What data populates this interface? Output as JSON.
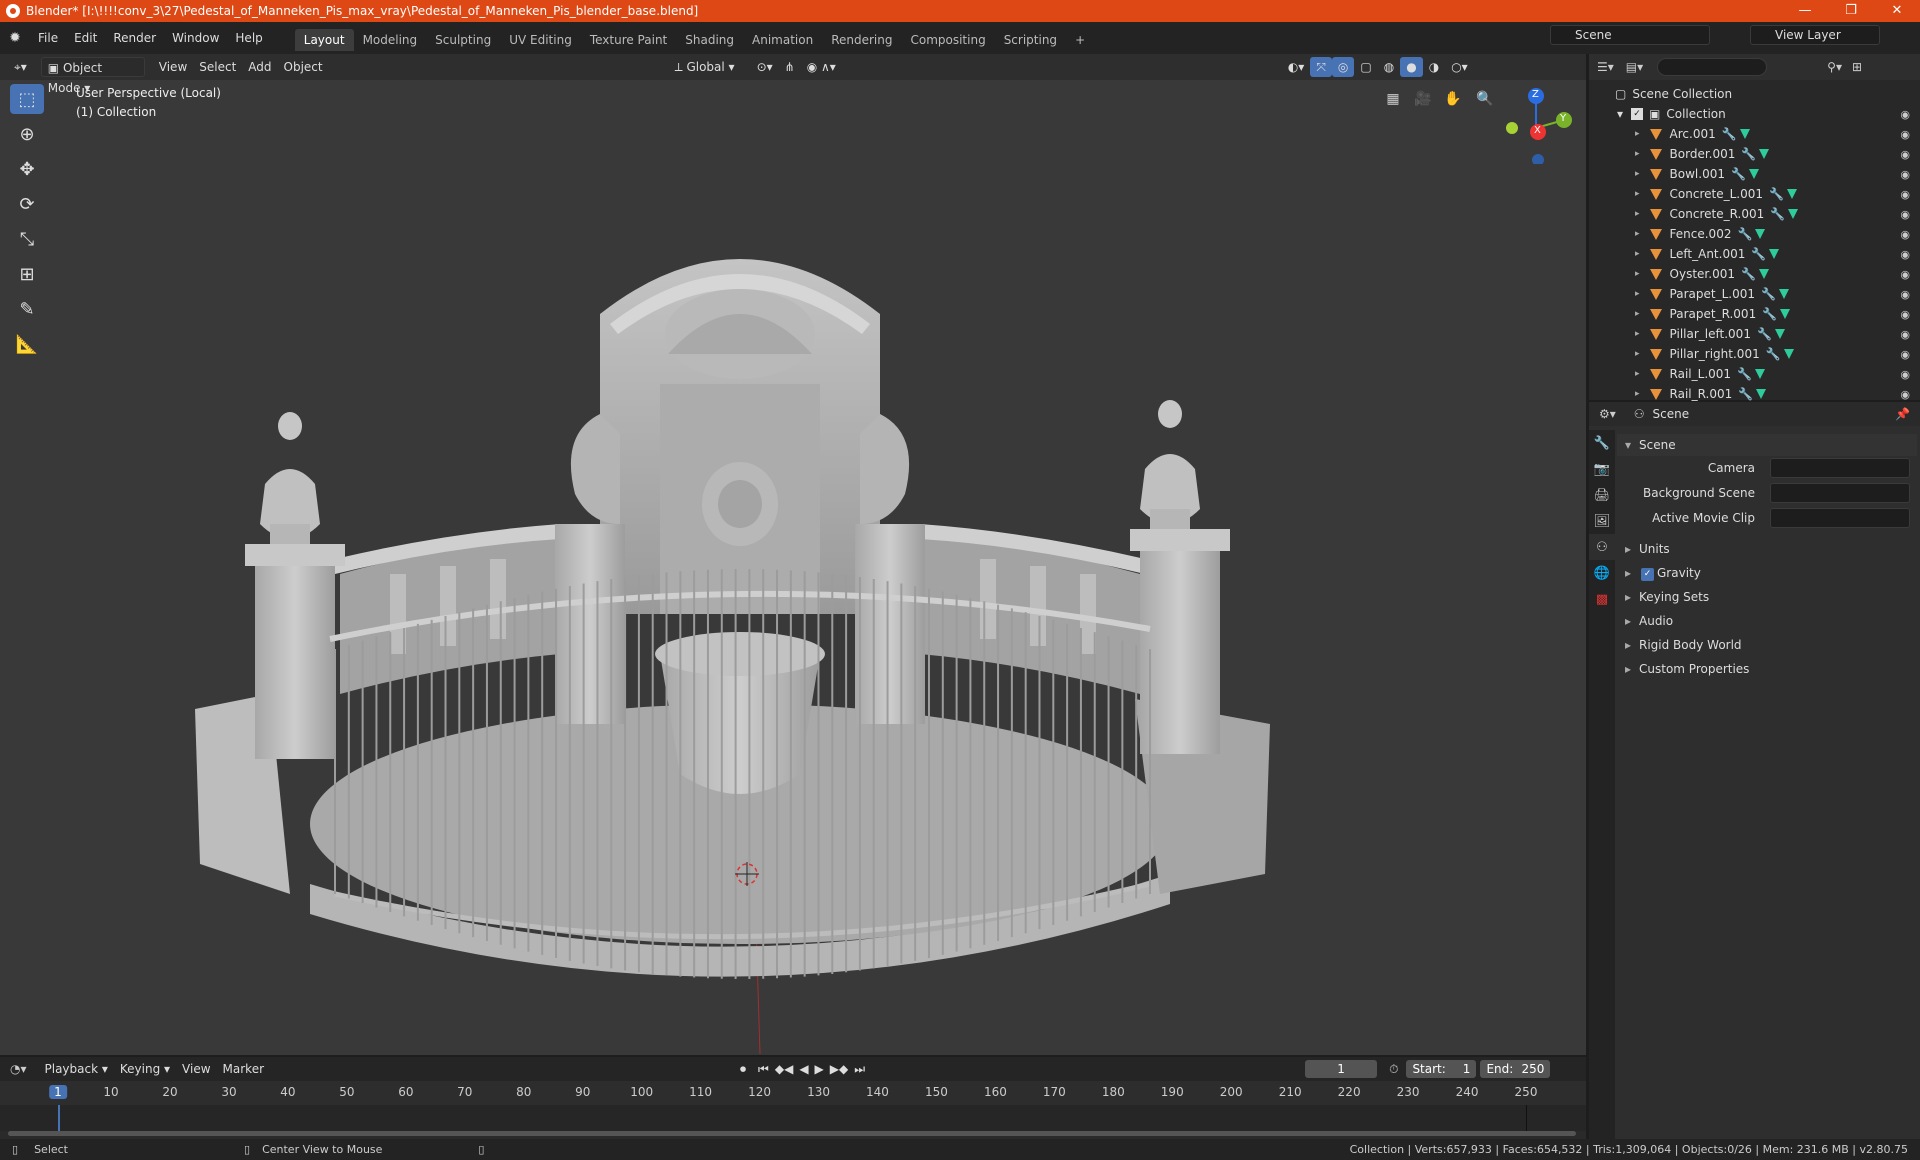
{
  "window": {
    "title": "Blender* [I:\\!!!!conv_3\\27\\Pedestal_of_Manneken_Pis_max_vray\\Pedestal_of_Manneken_Pis_blender_base.blend]",
    "min": "—",
    "max": "❐",
    "close": "✕"
  },
  "menu": [
    "File",
    "Edit",
    "Render",
    "Window",
    "Help"
  ],
  "workspaces": [
    "Layout",
    "Modeling",
    "Sculpting",
    "UV Editing",
    "Texture Paint",
    "Shading",
    "Animation",
    "Rendering",
    "Compositing",
    "Scripting"
  ],
  "workspace_add": "+",
  "scene_name": "Scene",
  "view_layer": "View Layer",
  "viewport": {
    "mode": "Object Mode",
    "menus": [
      "View",
      "Select",
      "Add",
      "Object"
    ],
    "orientation": "Global",
    "perspective_label": "User Perspective (Local)",
    "collection_label": "(1) Collection",
    "gizmo": {
      "z": "Z",
      "y": "Y",
      "x": "X"
    }
  },
  "outliner": {
    "search_placeholder": "",
    "root": "Scene Collection",
    "collection": "Collection",
    "items": [
      "Arc.001",
      "Border.001",
      "Bowl.001",
      "Concrete_L.001",
      "Concrete_R.001",
      "Fence.002",
      "Left_Ant.001",
      "Oyster.001",
      "Parapet_L.001",
      "Parapet_R.001",
      "Pillar_left.001",
      "Pillar_right.001",
      "Rail_L.001",
      "Rail_R.001"
    ]
  },
  "properties": {
    "context": "Scene",
    "panel_scene": "Scene",
    "camera_label": "Camera",
    "bg_scene_label": "Background Scene",
    "movie_clip_label": "Active Movie Clip",
    "panels": [
      "Units",
      "Gravity",
      "Keying Sets",
      "Audio",
      "Rigid Body World",
      "Custom Properties"
    ]
  },
  "timeline": {
    "menus": [
      "Playback",
      "Keying",
      "View",
      "Marker"
    ],
    "current_frame": "1",
    "start_label": "Start:",
    "start": "1",
    "end_label": "End:",
    "end": "250",
    "ticks": [
      "1",
      "10",
      "20",
      "30",
      "40",
      "50",
      "60",
      "70",
      "80",
      "90",
      "100",
      "110",
      "120",
      "130",
      "140",
      "150",
      "160",
      "170",
      "180",
      "190",
      "200",
      "210",
      "220",
      "230",
      "240",
      "250"
    ]
  },
  "status": {
    "select": "Select",
    "center": "Center View to Mouse",
    "stats": "Collection | Verts:657,933 | Faces:654,532 | Tris:1,309,064 | Objects:0/26 | Mem: 231.6 MB | v2.80.75"
  }
}
